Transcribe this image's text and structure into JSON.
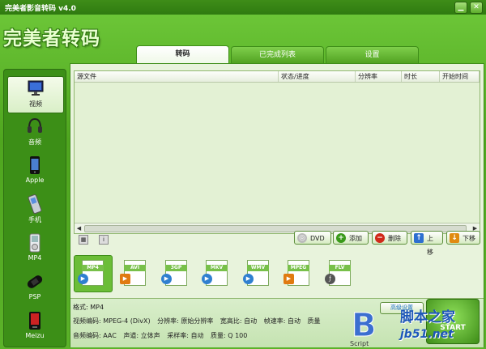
{
  "window": {
    "title": "完美者影音转码 v4.0",
    "minimize_glyph": "▁",
    "close_glyph": "✕"
  },
  "logo_text": "完美者转码",
  "tabs": [
    {
      "label": "转码"
    },
    {
      "label": "已完成列表"
    },
    {
      "label": "设置"
    }
  ],
  "sidebar": {
    "items": [
      {
        "label": "视频",
        "icon": "monitor-icon"
      },
      {
        "label": "音频",
        "icon": "headphones-icon"
      },
      {
        "label": "Apple",
        "icon": "iphone-icon"
      },
      {
        "label": "手机",
        "icon": "mobile-phone-icon"
      },
      {
        "label": "MP4",
        "icon": "mp4-player-icon"
      },
      {
        "label": "PSP",
        "icon": "psp-icon"
      },
      {
        "label": "Meizu",
        "icon": "meizu-player-icon"
      }
    ]
  },
  "file_list": {
    "columns": [
      "源文件",
      "状态/进度",
      "分辨率",
      "时长",
      "开始时间"
    ],
    "rows": []
  },
  "actions": {
    "dvd": "DVD",
    "add": "添加",
    "delete": "删除",
    "up": "上移",
    "down": "下移"
  },
  "formats": [
    {
      "label": "MP4"
    },
    {
      "label": "AVI"
    },
    {
      "label": "3GP"
    },
    {
      "label": "MKV"
    },
    {
      "label": "WMV"
    },
    {
      "label": "MPEG"
    },
    {
      "label": "FLV"
    }
  ],
  "info": {
    "format": "格式: MP4",
    "video_codec": "视频编码: MPEG-4 (DivX)",
    "resolution": "分辨率: 原始分辨率",
    "aspect": "宽高比: 自动",
    "framerate": "帧速率: 自动",
    "quality": "质量",
    "audio_codec": "音频编码: AAC",
    "channels": "声道: 立体声",
    "samplerate": "采样率: 自动",
    "audio_quality": "质量: Q 100",
    "advanced_btn": "高级设置",
    "start_btn": "START"
  },
  "watermark": {
    "site": "脚本之家",
    "url": "jb51.net",
    "mark": "Script"
  },
  "colors": {
    "accent": "#4fa61f",
    "dark": "#2f7a10",
    "panel": "#e8f3dc"
  }
}
